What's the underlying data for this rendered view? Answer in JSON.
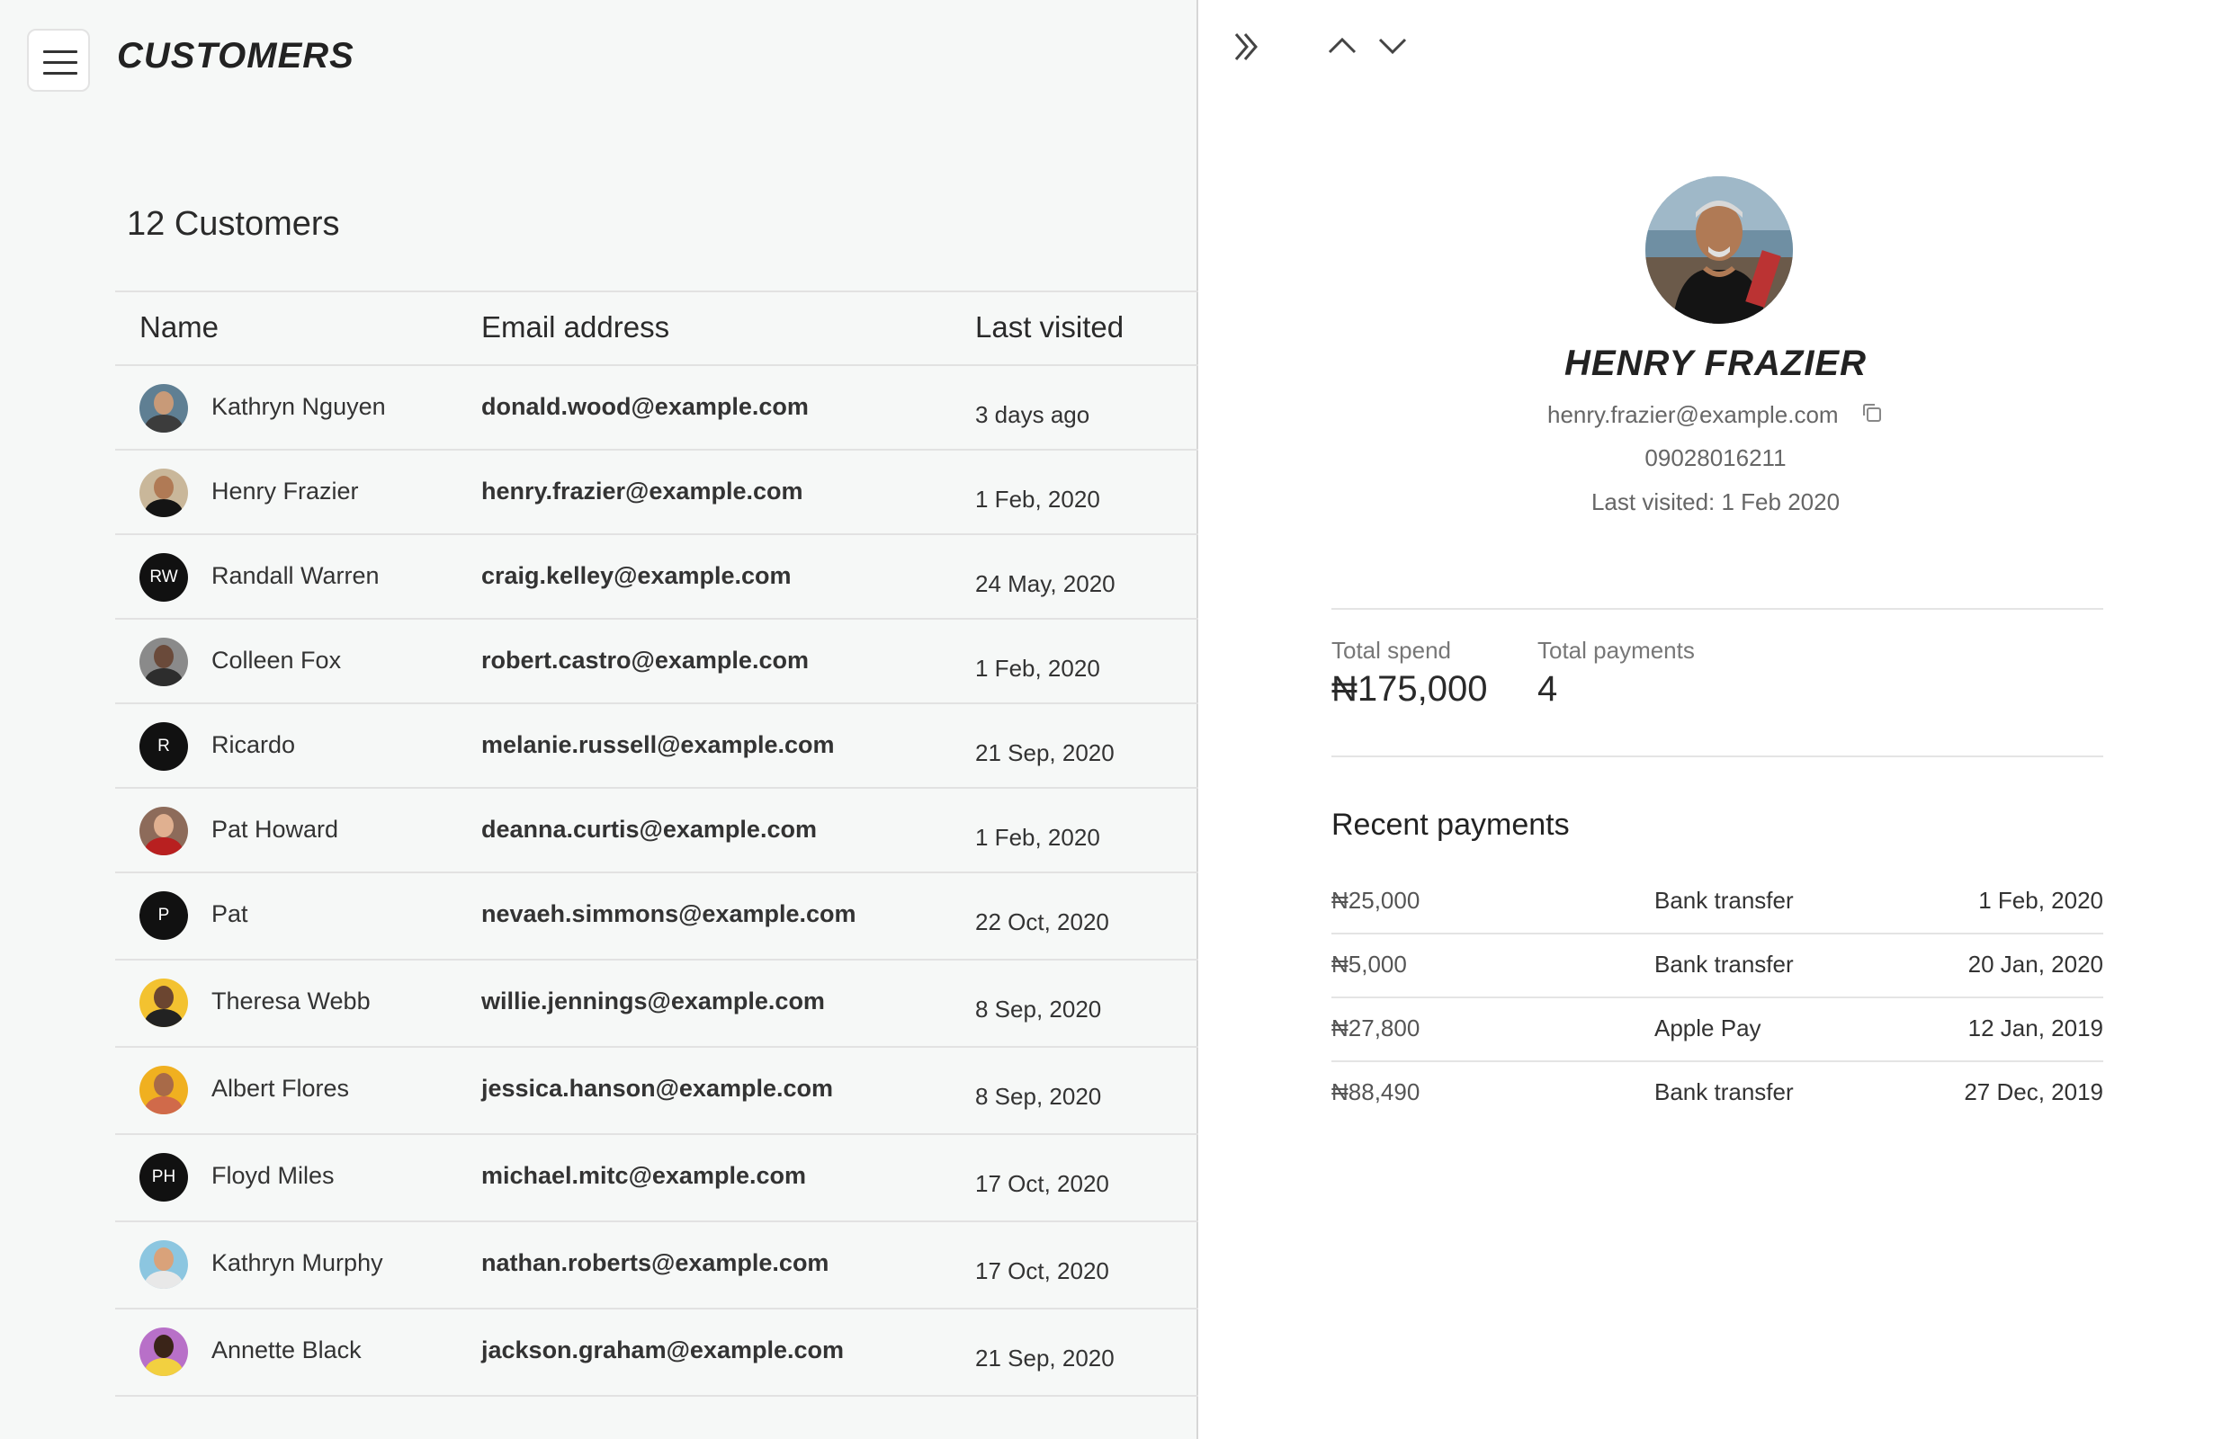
{
  "header": {
    "title": "CUSTOMERS",
    "menu_icon": "hamburger-menu-icon"
  },
  "list": {
    "count_label": "12 Customers",
    "columns": {
      "name": "Name",
      "email": "Email address",
      "last_visited": "Last visited"
    },
    "rows": [
      {
        "name": "Kathryn Nguyen",
        "email": "donald.wood@example.com",
        "last_visited": "3 days ago",
        "avatar": "photo"
      },
      {
        "name": "Henry Frazier",
        "email": "henry.frazier@example.com",
        "last_visited": "1 Feb, 2020",
        "avatar": "photo"
      },
      {
        "name": "Randall Warren",
        "email": "craig.kelley@example.com",
        "last_visited": "24 May, 2020",
        "avatar": "RW"
      },
      {
        "name": "Colleen Fox",
        "email": "robert.castro@example.com",
        "last_visited": "1 Feb, 2020",
        "avatar": "photo"
      },
      {
        "name": "Ricardo",
        "email": "melanie.russell@example.com",
        "last_visited": "21 Sep, 2020",
        "avatar": "R"
      },
      {
        "name": "Pat Howard",
        "email": "deanna.curtis@example.com",
        "last_visited": "1 Feb, 2020",
        "avatar": "photo"
      },
      {
        "name": "Pat",
        "email": "nevaeh.simmons@example.com",
        "last_visited": "22 Oct, 2020",
        "avatar": "P"
      },
      {
        "name": "Theresa Webb",
        "email": "willie.jennings@example.com",
        "last_visited": "8 Sep, 2020",
        "avatar": "photo"
      },
      {
        "name": "Albert Flores",
        "email": "jessica.hanson@example.com",
        "last_visited": "8 Sep, 2020",
        "avatar": "photo"
      },
      {
        "name": "Floyd Miles",
        "email": "michael.mitc@example.com",
        "last_visited": "17 Oct, 2020",
        "avatar": "PH"
      },
      {
        "name": "Kathryn Murphy",
        "email": "nathan.roberts@example.com",
        "last_visited": "17 Oct, 2020",
        "avatar": "photo"
      },
      {
        "name": "Annette Black",
        "email": "jackson.graham@example.com",
        "last_visited": "21 Sep, 2020",
        "avatar": "photo"
      }
    ]
  },
  "detail": {
    "nav_icons": [
      "collapse-panel-icon",
      "chevron-up-icon",
      "chevron-down-icon"
    ],
    "name": "HENRY FRAZIER",
    "email": "henry.frazier@example.com",
    "phone": "09028016211",
    "last_visited": "Last visited: 1 Feb 2020",
    "total_spend_label": "Total spend",
    "total_spend_value": "₦175,000",
    "total_payments_label": "Total payments",
    "total_payments_value": "4",
    "recent_title": "Recent payments",
    "payments": [
      {
        "amount": "₦25,000",
        "method": "Bank transfer",
        "date": "1 Feb, 2020"
      },
      {
        "amount": "₦5,000",
        "method": "Bank transfer",
        "date": "20 Jan, 2020"
      },
      {
        "amount": "₦27,800",
        "method": "Apple Pay",
        "date": "12 Jan, 2019"
      },
      {
        "amount": "₦88,490",
        "method": "Bank transfer",
        "date": "27 Dec, 2019"
      }
    ]
  },
  "colors": {
    "left_bg": "#f6f8f7",
    "text": "#222222",
    "muted": "#666666",
    "divider": "#e2e2e2",
    "initials_bg": "#111111"
  }
}
